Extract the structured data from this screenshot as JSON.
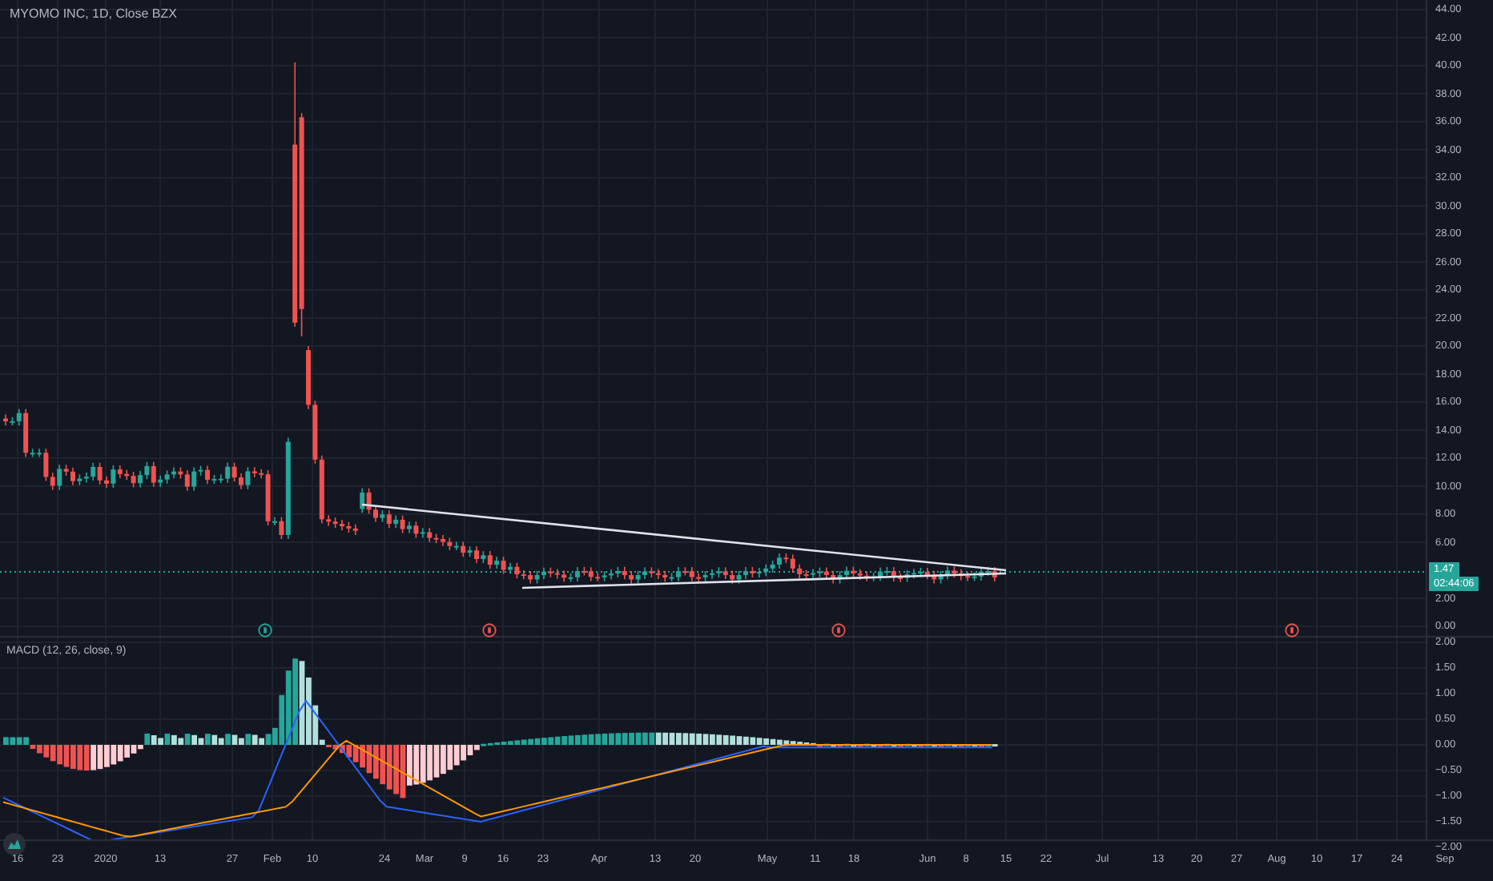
{
  "chart_title": "MYOMO INC, 1D, Close BZX",
  "price_axis": {
    "ticks": [
      "44.00",
      "42.00",
      "40.00",
      "38.00",
      "36.00",
      "34.00",
      "32.00",
      "30.00",
      "28.00",
      "26.00",
      "24.00",
      "22.00",
      "20.00",
      "18.00",
      "16.00",
      "14.00",
      "12.00",
      "10.00",
      "8.00",
      "6.00",
      "2.00",
      "0.00"
    ]
  },
  "last_price": "1.47",
  "countdown": "02:44:06",
  "events": [
    {
      "color": "#26a69a"
    },
    {
      "color": "#ef5350"
    },
    {
      "color": "#ef5350"
    },
    {
      "color": "#ef5350"
    }
  ],
  "indicator": {
    "title": "MACD (12, 26, close, 9)",
    "axis_ticks": [
      "2.00",
      "1.50",
      "1.00",
      "0.50",
      "0.00",
      "−0.50",
      "−1.00",
      "−1.50",
      "−2.00"
    ]
  },
  "time_axis": {
    "ticks": [
      "16",
      "23",
      "2020",
      "13",
      "27",
      "Feb",
      "10",
      "24",
      "Mar",
      "9",
      "16",
      "23",
      "Apr",
      "13",
      "20",
      "May",
      "11",
      "18",
      "Jun",
      "8",
      "15",
      "22",
      "Jul",
      "13",
      "20",
      "27",
      "Aug",
      "10",
      "17",
      "24",
      "Sep"
    ]
  }
}
